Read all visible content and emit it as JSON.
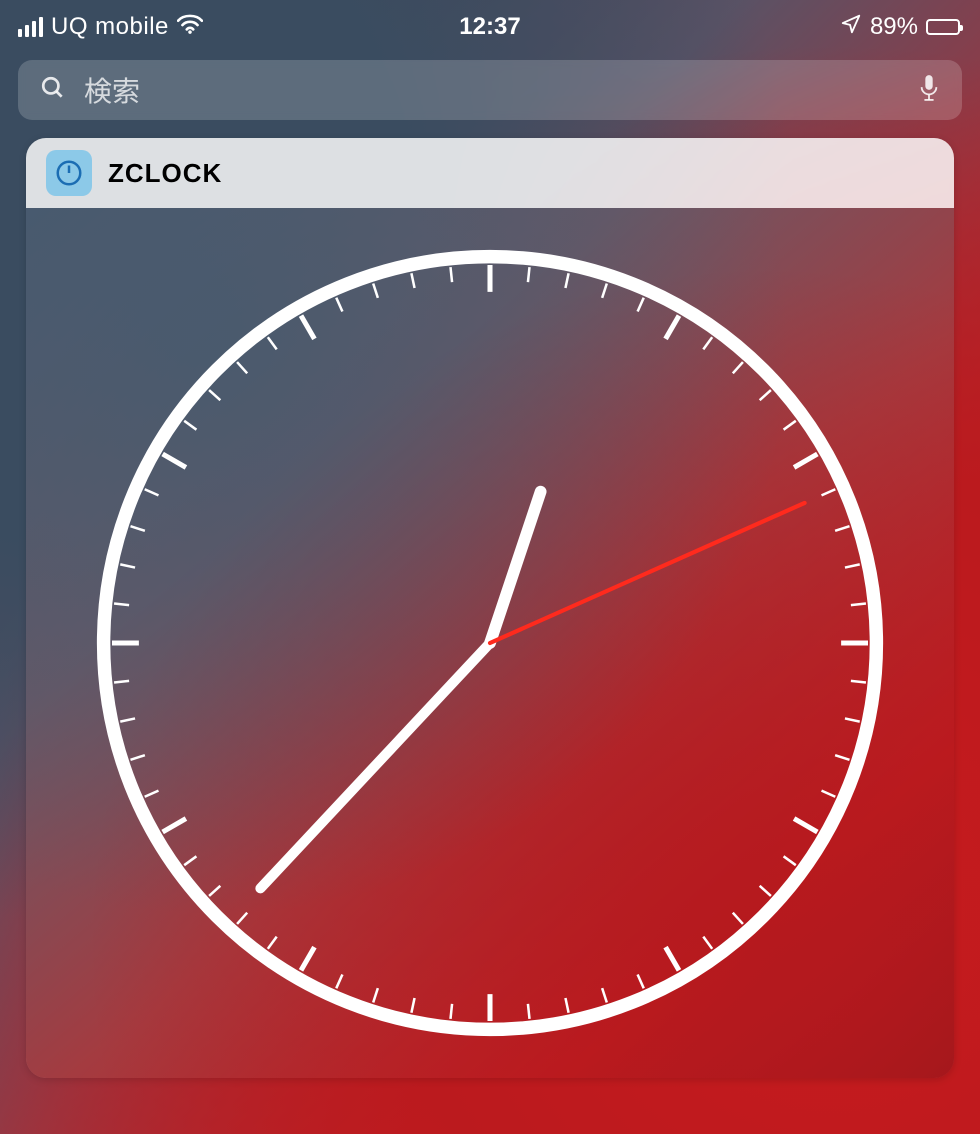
{
  "status_bar": {
    "carrier": "UQ mobile",
    "time": "12:37",
    "battery_percent_text": "89%",
    "battery_fill_width": "89%"
  },
  "search": {
    "placeholder": "検索"
  },
  "widget": {
    "title": "ZCLOCK",
    "clock": {
      "hours": 12,
      "minutes": 37,
      "seconds": 11,
      "hand_color": "#ffffff",
      "second_hand_color": "#ff2a1d"
    }
  }
}
